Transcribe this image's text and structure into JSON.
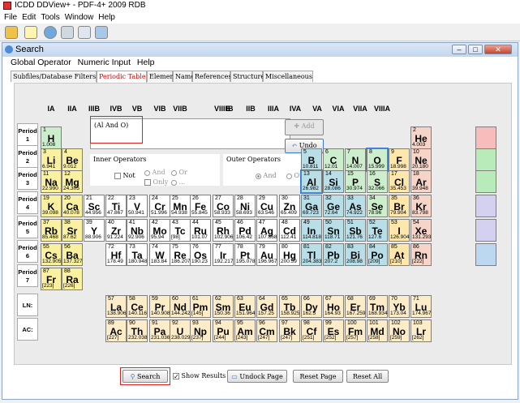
{
  "app": {
    "title": "ICDD DDView+ - PDF-4+ 2009 RDB",
    "menu": [
      "File",
      "Edit",
      "Tools",
      "Window",
      "Help"
    ]
  },
  "toolbar": {
    "icons": [
      "folder-icon",
      "checklist-icon",
      "globe-icon",
      "tools-icon",
      "pointer-icon",
      "camera-icon"
    ]
  },
  "window": {
    "title": "Search",
    "menu": [
      "Global Operator",
      "Numeric Input",
      "Help"
    ],
    "tabs": [
      "Subfiles/Database Filters",
      "Periodic Table",
      "Elements",
      "Names",
      "References",
      "Structures",
      "Miscellaneous"
    ],
    "active_tab": "Periodic Table"
  },
  "query": {
    "text": "(Al And O)",
    "add_label": "Add",
    "undo_label": "Undo"
  },
  "operators": {
    "inner_title": "Inner Operators",
    "outer_title": "Outer Operators",
    "not": "Not",
    "and": "And",
    "or": "Or",
    "only": "Only",
    "ellipsis": "...",
    "outer_and": "And",
    "outer_or": "Or"
  },
  "groups": [
    "IA",
    "IIA",
    "IIIB",
    "IVB",
    "VB",
    "VIB",
    "VIIB",
    "VIIIB",
    "IB",
    "IIB",
    "IIIA",
    "IVA",
    "VA",
    "VIA",
    "VIIA",
    "VIIIA"
  ],
  "periods": [
    "Period 1",
    "Period 2",
    "Period 3",
    "Period 4",
    "Period 5",
    "Period 6",
    "Period 7"
  ],
  "series_labels": [
    "LN:",
    "AC:"
  ],
  "elements": [
    [
      "1",
      "H",
      "1.008",
      0,
      0
    ],
    [
      "2",
      "He",
      "4.003",
      0,
      17
    ],
    [
      "3",
      "Li",
      "6.941",
      1,
      0
    ],
    [
      "4",
      "Be",
      "9.012",
      1,
      1
    ],
    [
      "5",
      "B",
      "10.811",
      1,
      12
    ],
    [
      "6",
      "C",
      "12.01",
      1,
      13
    ],
    [
      "7",
      "N",
      "14.007",
      1,
      14
    ],
    [
      "8",
      "O",
      "15.999",
      1,
      15
    ],
    [
      "9",
      "F",
      "18.998",
      1,
      16
    ],
    [
      "10",
      "Ne",
      "20.180",
      1,
      17
    ],
    [
      "11",
      "Na",
      "22.990",
      2,
      0
    ],
    [
      "12",
      "Mg",
      "24.305",
      2,
      1
    ],
    [
      "13",
      "Al",
      "26.982",
      2,
      12
    ],
    [
      "14",
      "Si",
      "28.086",
      2,
      13
    ],
    [
      "15",
      "P",
      "30.974",
      2,
      14
    ],
    [
      "16",
      "S",
      "32.066",
      2,
      15
    ],
    [
      "17",
      "Cl",
      "35.453",
      2,
      16
    ],
    [
      "18",
      "Ar",
      "39.948",
      2,
      17
    ],
    [
      "19",
      "K",
      "39.098",
      3,
      0
    ],
    [
      "20",
      "Ca",
      "40.078",
      3,
      1
    ],
    [
      "21",
      "Sc",
      "44.956",
      3,
      2
    ],
    [
      "22",
      "Ti",
      "47.867",
      3,
      3
    ],
    [
      "23",
      "V",
      "50.941",
      3,
      4
    ],
    [
      "24",
      "Cr",
      "51.996",
      3,
      5
    ],
    [
      "25",
      "Mn",
      "54.938",
      3,
      6
    ],
    [
      "26",
      "Fe",
      "55.845",
      3,
      7
    ],
    [
      "27",
      "Co",
      "58.933",
      3,
      8
    ],
    [
      "28",
      "Ni",
      "58.693",
      3,
      9
    ],
    [
      "29",
      "Cu",
      "63.546",
      3,
      10
    ],
    [
      "30",
      "Zn",
      "65.409",
      3,
      11
    ],
    [
      "31",
      "Ga",
      "69.723",
      3,
      12
    ],
    [
      "32",
      "Ge",
      "72.64",
      3,
      13
    ],
    [
      "33",
      "As",
      "74.922",
      3,
      14
    ],
    [
      "34",
      "Se",
      "78.96",
      3,
      15
    ],
    [
      "35",
      "Br",
      "79.904",
      3,
      16
    ],
    [
      "36",
      "Kr",
      "83.798",
      3,
      17
    ],
    [
      "37",
      "Rb",
      "85.468",
      4,
      0
    ],
    [
      "38",
      "Sr",
      "87.62",
      4,
      1
    ],
    [
      "39",
      "Y",
      "88.906",
      4,
      2
    ],
    [
      "40",
      "Zr",
      "91.224",
      4,
      3
    ],
    [
      "41",
      "Nb",
      "92.906",
      4,
      4
    ],
    [
      "42",
      "Mo",
      "95.94",
      4,
      5
    ],
    [
      "43",
      "Tc",
      "[98]",
      4,
      6
    ],
    [
      "44",
      "Ru",
      "101.07",
      4,
      7
    ],
    [
      "45",
      "Rh",
      "102.906",
      4,
      8
    ],
    [
      "46",
      "Pd",
      "106.42",
      4,
      9
    ],
    [
      "47",
      "Ag",
      "107.868",
      4,
      10
    ],
    [
      "48",
      "Cd",
      "112.41",
      4,
      11
    ],
    [
      "49",
      "In",
      "114.818",
      4,
      12
    ],
    [
      "50",
      "Sn",
      "118.71",
      4,
      13
    ],
    [
      "51",
      "Sb",
      "121.76",
      4,
      14
    ],
    [
      "52",
      "Te",
      "127.6",
      4,
      15
    ],
    [
      "53",
      "I",
      "126.904",
      4,
      16
    ],
    [
      "54",
      "Xe",
      "131.293",
      4,
      17
    ],
    [
      "55",
      "Cs",
      "132.905",
      5,
      0
    ],
    [
      "56",
      "Ba",
      "137.327",
      5,
      1
    ],
    [
      "72",
      "Hf",
      "178.49",
      5,
      3
    ],
    [
      "73",
      "Ta",
      "180.948",
      5,
      4
    ],
    [
      "74",
      "W",
      "183.84",
      5,
      5
    ],
    [
      "75",
      "Re",
      "186.207",
      5,
      6
    ],
    [
      "76",
      "Os",
      "190.23",
      5,
      7
    ],
    [
      "77",
      "Ir",
      "192.217",
      5,
      8
    ],
    [
      "78",
      "Pt",
      "195.078",
      5,
      9
    ],
    [
      "79",
      "Au",
      "196.967",
      5,
      10
    ],
    [
      "80",
      "Hg",
      "200.59",
      5,
      11
    ],
    [
      "81",
      "Tl",
      "204.383",
      5,
      12
    ],
    [
      "82",
      "Pb",
      "207.2",
      5,
      13
    ],
    [
      "83",
      "Bi",
      "208.98",
      5,
      14
    ],
    [
      "84",
      "Po",
      "[209]",
      5,
      15
    ],
    [
      "85",
      "At",
      "[210]",
      5,
      16
    ],
    [
      "86",
      "Rn",
      "[222]",
      5,
      17
    ],
    [
      "87",
      "Fr",
      "[223]",
      6,
      0
    ],
    [
      "88",
      "Ra",
      "[226]",
      6,
      1
    ],
    [
      "57",
      "La",
      "138.906",
      7,
      3
    ],
    [
      "58",
      "Ce",
      "140.116",
      7,
      4
    ],
    [
      "59",
      "Pr",
      "140.908",
      7,
      5
    ],
    [
      "60",
      "Nd",
      "144.242",
      7,
      6
    ],
    [
      "61",
      "Pm",
      "[145]",
      7,
      7
    ],
    [
      "62",
      "Sm",
      "150.36",
      7,
      8
    ],
    [
      "63",
      "Eu",
      "151.964",
      7,
      9
    ],
    [
      "64",
      "Gd",
      "157.25",
      7,
      10
    ],
    [
      "65",
      "Tb",
      "158.925",
      7,
      11
    ],
    [
      "66",
      "Dy",
      "162.5",
      7,
      12
    ],
    [
      "67",
      "Ho",
      "164.93",
      7,
      13
    ],
    [
      "68",
      "Er",
      "167.259",
      7,
      14
    ],
    [
      "69",
      "Tm",
      "168.934",
      7,
      15
    ],
    [
      "70",
      "Yb",
      "173.04",
      7,
      16
    ],
    [
      "71",
      "Lu",
      "174.967",
      7,
      17
    ],
    [
      "89",
      "Ac",
      "[227]",
      8,
      3
    ],
    [
      "90",
      "Th",
      "232.038",
      8,
      4
    ],
    [
      "91",
      "Pa",
      "231.036",
      8,
      5
    ],
    [
      "92",
      "U",
      "238.029",
      8,
      6
    ],
    [
      "93",
      "Np",
      "[237]",
      8,
      7
    ],
    [
      "94",
      "Pu",
      "[244]",
      8,
      8
    ],
    [
      "95",
      "Am",
      "[243]",
      8,
      9
    ],
    [
      "96",
      "Cm",
      "[247]",
      8,
      10
    ],
    [
      "97",
      "Bk",
      "[247]",
      8,
      11
    ],
    [
      "98",
      "Cf",
      "[251]",
      8,
      12
    ],
    [
      "99",
      "Es",
      "[252]",
      8,
      13
    ],
    [
      "100",
      "Fm",
      "[257]",
      8,
      14
    ],
    [
      "101",
      "Md",
      "[258]",
      8,
      15
    ],
    [
      "102",
      "No",
      "[259]",
      8,
      16
    ],
    [
      "103",
      "Lr",
      "[262]",
      8,
      17
    ]
  ],
  "colors": {
    "alkali": "#f9f0a0",
    "alkaline": "#f9f0a0",
    "transition": "#ffffff",
    "metalloid": "#b8dfe8",
    "nonmetal": "#cdeecd",
    "halogen": "#ffe6aa",
    "noble": "#f7d4c8",
    "lanthanide": "#fdecc8",
    "hydrogen": "#cdeecd",
    "side_green": "#b9eab9",
    "side_red": "#f7bdbd",
    "side_purple": "#d4d0f0",
    "side_blue": "#bcd8f0"
  },
  "bottom": {
    "search": "Search",
    "show_results": "Show Results",
    "undock": "Undock Page",
    "reset_page": "Reset Page",
    "reset_all": "Reset All"
  }
}
